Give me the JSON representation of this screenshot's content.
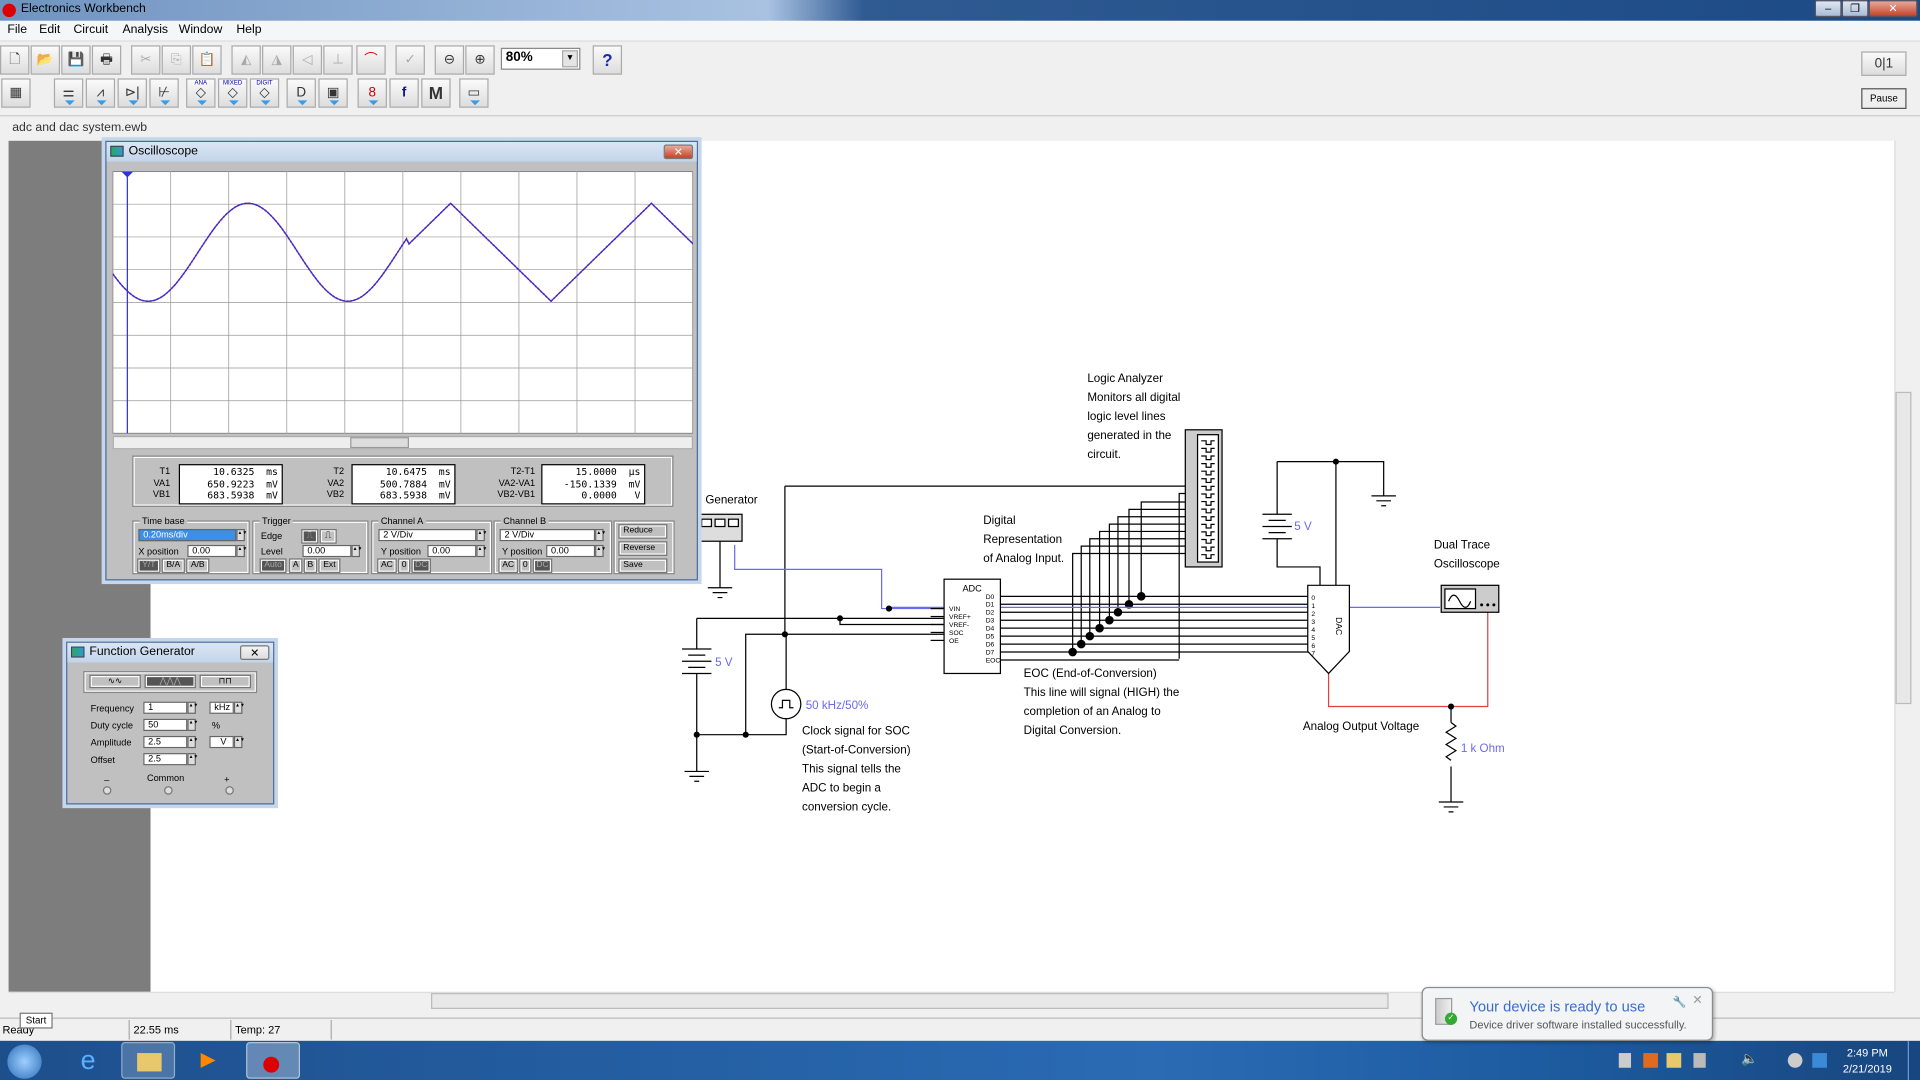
{
  "app": {
    "title": "Electronics Workbench",
    "window_controls": [
      "minimize",
      "restore",
      "close"
    ]
  },
  "menu": [
    "File",
    "Edit",
    "Circuit",
    "Analysis",
    "Window",
    "Help"
  ],
  "toolbar1": {
    "icons": [
      "new-icon",
      "open-icon",
      "save-icon",
      "print-icon",
      "cut-icon",
      "copy-icon",
      "paste-icon",
      "rotate-icon",
      "flip-horizontal-icon",
      "flip-vertical-icon",
      "component-properties-icon",
      "analysis-graphs-icon",
      "subcircuit-icon",
      "zoom-out-icon",
      "zoom-in-icon"
    ],
    "zoom": "80%",
    "help": "?"
  },
  "toolbar2": {
    "bins": [
      {
        "name": "sources"
      },
      {
        "name": "basic"
      },
      {
        "name": "diodes"
      },
      {
        "name": "transistors"
      },
      {
        "name": "analog-ics",
        "label": "ANA"
      },
      {
        "name": "mixed-ics",
        "label": "MIXED"
      },
      {
        "name": "digital-ics",
        "label": "DIGIT"
      },
      {
        "name": "logic-gates"
      },
      {
        "name": "digital"
      },
      {
        "name": "indicators"
      },
      {
        "name": "controls",
        "label": "f"
      },
      {
        "name": "miscellaneous",
        "label": "M"
      },
      {
        "name": "instruments"
      }
    ]
  },
  "pause_label": "Pause",
  "document": {
    "title": "adc and dac system.ewb"
  },
  "oscilloscope": {
    "title": "Oscilloscope",
    "readouts": {
      "t1": {
        "label": "T1",
        "value": "10.6325  ms"
      },
      "va1": {
        "label": "VA1",
        "value": "650.9223  mV"
      },
      "vb1": {
        "label": "VB1",
        "value": "683.5938  mV"
      },
      "t2": {
        "label": "T2",
        "value": "10.6475  ms"
      },
      "va2": {
        "label": "VA2",
        "value": "500.7884  mV"
      },
      "vb2": {
        "label": "VB2",
        "value": "683.5938  mV"
      },
      "dt": {
        "label": "T2-T1",
        "value": "15.0000  µs"
      },
      "dva": {
        "label": "VA2-VA1",
        "value": "-150.1339  mV"
      },
      "dvb": {
        "label": "VB2-VB1",
        "value": "0.0000   V"
      }
    },
    "timebase": {
      "title": "Time base",
      "value": "0.20ms/div",
      "xpos_label": "X position",
      "xpos": "0.00",
      "modes": [
        "Y/T",
        "B/A",
        "A/B"
      ],
      "active_mode": "Y/T"
    },
    "trigger": {
      "title": "Trigger",
      "edge_label": "Edge",
      "level_label": "Level",
      "level": "0.00",
      "sources": [
        "Auto",
        "A",
        "B",
        "Ext"
      ]
    },
    "channel_a": {
      "title": "Channel A",
      "scale": "2 V/Div",
      "ypos_label": "Y position",
      "ypos": "0.00",
      "coupling": [
        "AC",
        "0",
        "DC"
      ]
    },
    "channel_b": {
      "title": "Channel B",
      "scale": "2 V/Div",
      "ypos_label": "Y position",
      "ypos": "0.00",
      "coupling": [
        "AC",
        "0",
        "DC"
      ]
    },
    "buttons": {
      "reduce": "Reduce",
      "reverse": "Reverse",
      "save": "Save"
    },
    "colors": {
      "channel_a": "#e0202a",
      "channel_b": "#3030e0",
      "cursor1": "#3030e0"
    }
  },
  "function_generator": {
    "title": "Function Generator",
    "waveforms": [
      "sine",
      "triangle",
      "square"
    ],
    "selected_waveform": "triangle",
    "frequency": {
      "label": "Frequency",
      "value": "1",
      "unit": "kHz"
    },
    "duty": {
      "label": "Duty cycle",
      "value": "50",
      "unit": "%"
    },
    "amplitude": {
      "label": "Amplitude",
      "value": "2.5",
      "unit": "V"
    },
    "offset": {
      "label": "Offset",
      "value": "2.5"
    },
    "terminals": {
      "minus": "–",
      "common": "Common",
      "plus": "+"
    }
  },
  "circuit": {
    "fg_label": "al Generator",
    "vref_battery": "5 V",
    "dac_battery": "5 V",
    "clock_label": "50 kHz/50%",
    "resistor_label": "1 k Ohm",
    "adc": {
      "title": "ADC",
      "left_pins": [
        "VIN",
        "VREF+",
        "VREF-",
        "SOC",
        "OE"
      ],
      "right_pins": [
        "D0",
        "D1",
        "D2",
        "D3",
        "D4",
        "D5",
        "D6",
        "D7",
        "EOC"
      ]
    },
    "dac": {
      "title": "DAC",
      "pins": [
        "0",
        "1",
        "2",
        "3",
        "4",
        "5",
        "6",
        "7"
      ]
    },
    "notes": {
      "logic_analyzer": [
        "Logic Analyzer",
        "Monitors all digital",
        "logic level lines",
        "generated in the",
        "circuit."
      ],
      "digital_rep": [
        "Digital",
        "Representation",
        "of Analog Input."
      ],
      "eoc": [
        "EOC (End-of-Conversion)",
        "This line will signal (HIGH) the",
        "completion of an Analog to",
        "Digital Conversion."
      ],
      "clock": [
        "Clock signal for SOC",
        "(Start-of-Conversion)",
        "This signal tells the",
        "ADC to begin a",
        "conversion cycle."
      ],
      "scope": [
        "Dual Trace",
        "Oscilloscope"
      ],
      "output": "Analog Output Voltage"
    },
    "colors": {
      "wire": "#000000",
      "signal": "#6a6af0",
      "output": "#e04040"
    }
  },
  "status": {
    "ready": "Ready",
    "time": "22.55 ms",
    "temp": "Temp: 27",
    "start_tooltip": "Start"
  },
  "notification": {
    "title": "Your device is ready to use",
    "body": "Device driver software installed successfully."
  },
  "clock": {
    "time": "2:49 PM",
    "date": "2/21/2019"
  }
}
